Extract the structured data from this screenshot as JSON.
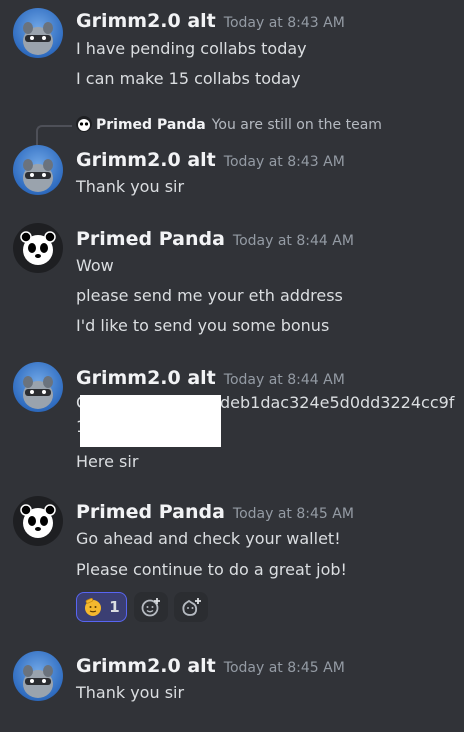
{
  "messages": [
    {
      "author": "Grimm2.0 alt",
      "time": "Today at 8:43 AM",
      "lines": [
        "I have pending collabs today",
        "I can make 15 collabs today"
      ]
    },
    {
      "reply": {
        "author": "Primed Panda",
        "text": "You are still on the team"
      },
      "author": "Grimm2.0 alt",
      "time": "Today at 8:43 AM",
      "lines": [
        "Thank you sir"
      ]
    },
    {
      "author": "Primed Panda",
      "time": "Today at 8:44 AM",
      "lines": [
        "Wow",
        "please send me your eth address",
        "I'd like to send you some bonus"
      ]
    },
    {
      "author": "Grimm2.0 alt",
      "time": "Today at 8:44 AM",
      "address_first_char": "C",
      "address_visible": "deb1dac324e5d0dd3224cc9f",
      "address_line2_first_char": "1",
      "lines": [
        "Here sir"
      ]
    },
    {
      "author": "Primed Panda",
      "time": "Today at 8:45 AM",
      "lines": [
        "Go ahead and check your wallet!",
        "Please continue to do a great job!"
      ],
      "reactions": [
        {
          "icon": "salute-emoji-icon",
          "count": "1",
          "active": true
        },
        {
          "icon": "add-reaction-icon",
          "count": ""
        },
        {
          "icon": "add-super-reaction-icon",
          "count": ""
        }
      ]
    },
    {
      "author": "Grimm2.0 alt",
      "time": "Today at 8:45 AM",
      "lines": [
        "Thank you sir"
      ]
    }
  ],
  "colors": {
    "background": "#313338",
    "active_reaction": "#5865f2"
  }
}
